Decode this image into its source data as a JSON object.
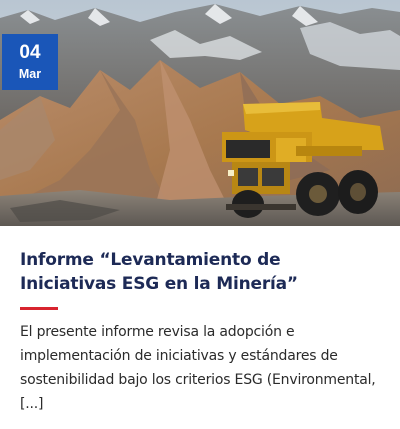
{
  "post": {
    "date": {
      "day": "04",
      "month": "Mar"
    },
    "title": "Informe “Levantamiento de Iniciativas ESG en la Minería”",
    "excerpt": "El presente informe revisa la adopción e implementación de iniciativas y estándares de sostenibilidad bajo los criterios ESG (Environmental,[...]",
    "image": {
      "subject": "mining-haul-truck-photo"
    }
  },
  "colors": {
    "badge": "#1a56b8",
    "title": "#1d2a56",
    "accent_rule": "#d8242f",
    "text": "#2b2b2b"
  }
}
